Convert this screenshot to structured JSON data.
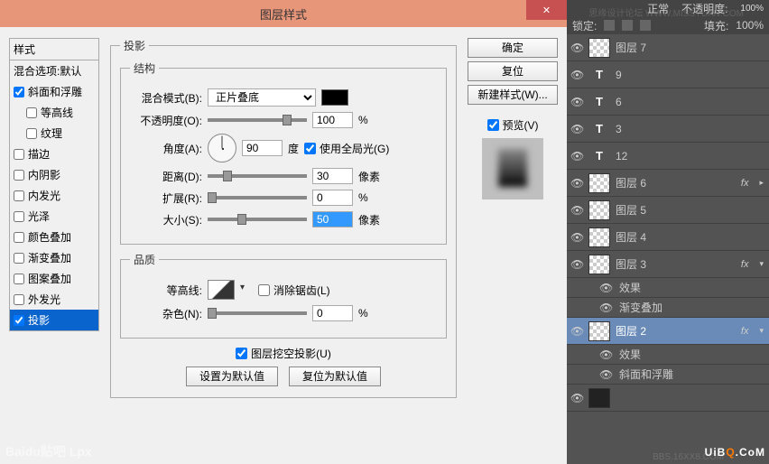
{
  "dialog": {
    "title": "图层样式",
    "close": "✕"
  },
  "styles": {
    "header": "样式",
    "blending_options": "混合选项:默认",
    "items": [
      {
        "label": "斜面和浮雕",
        "checked": true,
        "indent": false
      },
      {
        "label": "等高线",
        "checked": false,
        "indent": true
      },
      {
        "label": "纹理",
        "checked": false,
        "indent": true
      },
      {
        "label": "描边",
        "checked": false,
        "indent": false
      },
      {
        "label": "内阴影",
        "checked": false,
        "indent": false
      },
      {
        "label": "内发光",
        "checked": false,
        "indent": false
      },
      {
        "label": "光泽",
        "checked": false,
        "indent": false
      },
      {
        "label": "颜色叠加",
        "checked": false,
        "indent": false
      },
      {
        "label": "渐变叠加",
        "checked": false,
        "indent": false
      },
      {
        "label": "图案叠加",
        "checked": false,
        "indent": false
      },
      {
        "label": "外发光",
        "checked": false,
        "indent": false
      },
      {
        "label": "投影",
        "checked": true,
        "indent": false,
        "selected": true
      }
    ]
  },
  "shadow": {
    "group_title": "投影",
    "structure_title": "结构",
    "blend_mode_label": "混合模式(B):",
    "blend_mode_value": "正片叠底",
    "opacity_label": "不透明度(O):",
    "opacity_value": "100",
    "opacity_unit": "%",
    "angle_label": "角度(A):",
    "angle_value": "90",
    "angle_unit": "度",
    "global_light_label": "使用全局光(G)",
    "global_light_checked": true,
    "distance_label": "距离(D):",
    "distance_value": "30",
    "distance_unit": "像素",
    "spread_label": "扩展(R):",
    "spread_value": "0",
    "spread_unit": "%",
    "size_label": "大小(S):",
    "size_value": "50",
    "size_unit": "像素",
    "quality_title": "品质",
    "contour_label": "等高线:",
    "antialias_label": "消除锯齿(L)",
    "antialias_checked": false,
    "noise_label": "杂色(N):",
    "noise_value": "0",
    "noise_unit": "%",
    "knockout_label": "图层挖空投影(U)",
    "knockout_checked": true,
    "make_default": "设置为默认值",
    "reset_default": "复位为默认值"
  },
  "buttons": {
    "ok": "确定",
    "cancel": "复位",
    "new_style": "新建样式(W)...",
    "preview_label": "预览(V)",
    "preview_checked": true
  },
  "ps_panel": {
    "normal": "正常",
    "opacity_lbl": "不透明度:",
    "opacity_val": "100%",
    "lock": "锁定:",
    "fill_lbl": "填充:",
    "fill_val": "100%",
    "effects": "效果",
    "grad_overlay": "渐变叠加",
    "bevel": "斜面和浮雕"
  },
  "layers": [
    {
      "type": "bitmap",
      "name": "图层 7"
    },
    {
      "type": "text",
      "name": "9"
    },
    {
      "type": "text",
      "name": "6"
    },
    {
      "type": "text",
      "name": "3"
    },
    {
      "type": "text",
      "name": "12"
    },
    {
      "type": "bitmap",
      "name": "图层 6",
      "fx": true
    },
    {
      "type": "bitmap",
      "name": "图层 5"
    },
    {
      "type": "bitmap",
      "name": "图层 4"
    },
    {
      "type": "bitmap",
      "name": "图层 3",
      "fx": true,
      "expanded": true,
      "sub": [
        "效果",
        "渐变叠加"
      ]
    },
    {
      "type": "bitmap",
      "name": "图层 2",
      "fx": true,
      "expanded": true,
      "selected": true,
      "sub": [
        "效果",
        "斜面和浮雕"
      ]
    },
    {
      "type": "dark",
      "name": ""
    }
  ],
  "watermarks": {
    "missyuan": "思缘设计论坛 WWW.MISSYUAN.COM",
    "bbs": "BBS.16XX8.COM",
    "uibq_pre": "UiB",
    "uibq_o": "Q",
    "uibq_post": ".CoM",
    "baidu": "Baidu贴吧 Lpx"
  }
}
